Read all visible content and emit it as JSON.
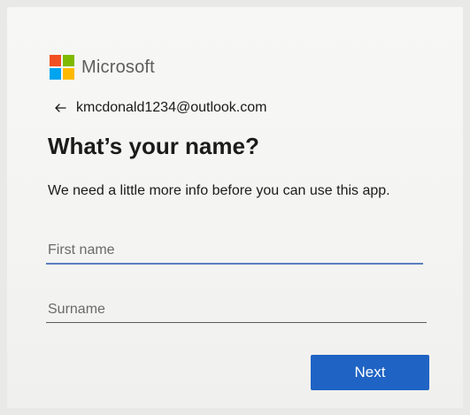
{
  "brand": {
    "name": "Microsoft",
    "colors": {
      "red": "#f25022",
      "green": "#7fba00",
      "blue": "#00a4ef",
      "yellow": "#ffb900"
    },
    "icon": "microsoft-logo-icon"
  },
  "account": {
    "back_icon": "arrow-left-icon",
    "email": "kmcdonald1234@outlook.com"
  },
  "heading": "What’s your name?",
  "description": "We need a little more info before you can use this app.",
  "form": {
    "first_name": {
      "value": "",
      "placeholder": "First name"
    },
    "surname": {
      "value": "",
      "placeholder": "Surname"
    }
  },
  "actions": {
    "next_label": "Next",
    "next_color": "#1f63c4"
  }
}
